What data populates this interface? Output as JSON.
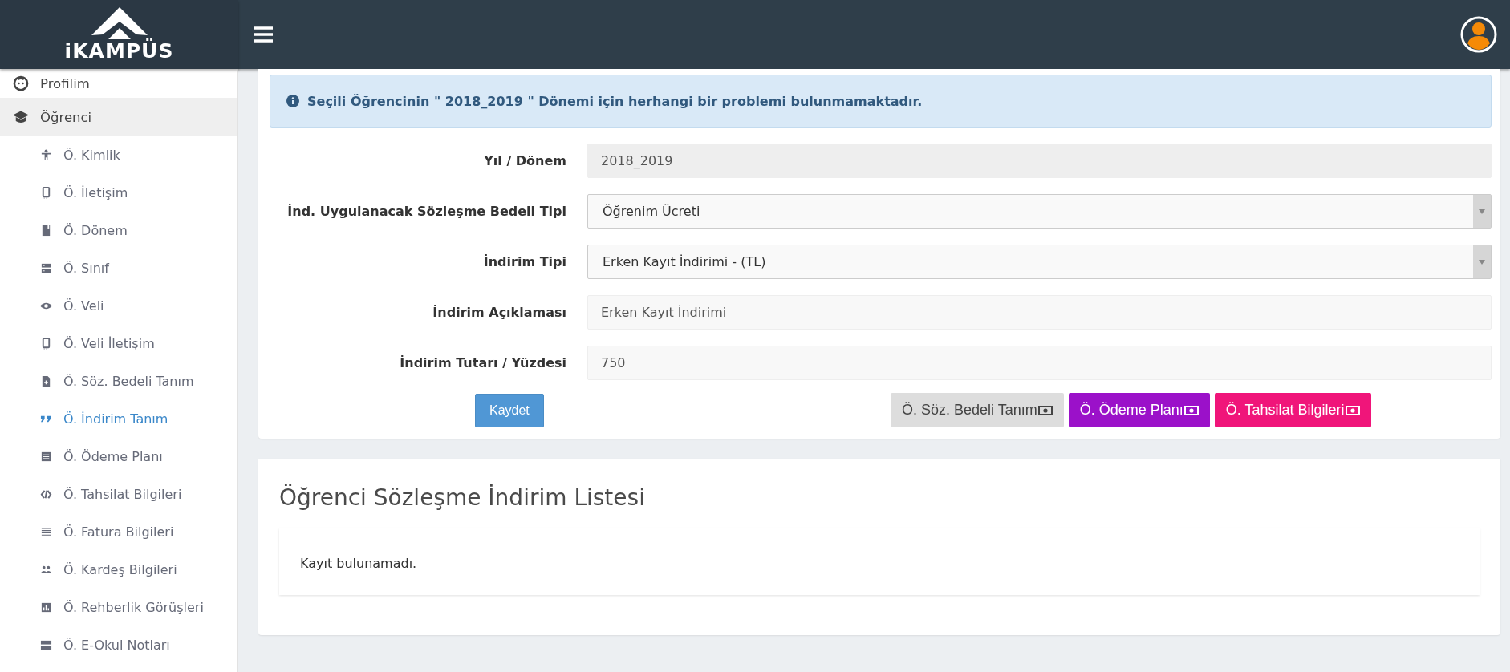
{
  "header": {
    "logo_text": "iKAMPÜS"
  },
  "sidebar": {
    "items": [
      {
        "label": "Profilim",
        "selected": false
      },
      {
        "label": "Öğrenci",
        "selected": true,
        "children": [
          {
            "label": "Ö. Kimlik",
            "selected": false
          },
          {
            "label": "Ö. İletişim",
            "selected": false
          },
          {
            "label": "Ö. Dönem",
            "selected": false
          },
          {
            "label": "Ö. Sınıf",
            "selected": false
          },
          {
            "label": "Ö. Veli",
            "selected": false
          },
          {
            "label": "Ö. Veli İletişim",
            "selected": false
          },
          {
            "label": "Ö. Söz. Bedeli Tanım",
            "selected": false
          },
          {
            "label": "Ö. İndirim Tanım",
            "selected": true
          },
          {
            "label": "Ö. Ödeme Planı",
            "selected": false
          },
          {
            "label": "Ö. Tahsilat Bilgileri",
            "selected": false
          },
          {
            "label": "Ö. Fatura Bilgileri",
            "selected": false
          },
          {
            "label": "Ö. Kardeş Bilgileri",
            "selected": false
          },
          {
            "label": "Ö. Rehberlik Görüşleri",
            "selected": false
          },
          {
            "label": "Ö. E-Okul Notları",
            "selected": false
          }
        ]
      }
    ]
  },
  "alert": {
    "text": "Seçili Öğrencinin \" 2018_2019 \" Dönemi için herhangi bir problemi bulunmamaktadır."
  },
  "form": {
    "fields": [
      {
        "label": "Yıl / Dönem",
        "kind": "readonly",
        "value": "2018_2019"
      },
      {
        "label": "İnd. Uygulanacak Sözleşme Bedeli Tipi",
        "kind": "select",
        "value": "Öğrenim Ücreti"
      },
      {
        "label": "İndirim Tipi",
        "kind": "select",
        "value": "Erken Kayıt İndirimi - (TL)"
      },
      {
        "label": "İndirim Açıklaması",
        "kind": "text",
        "value": "Erken Kayıt İndirimi"
      },
      {
        "label": "İndirim Tutarı / Yüzdesi",
        "kind": "text",
        "value": "750"
      }
    ],
    "save_button": "Kaydet",
    "link_buttons": [
      {
        "label": "Ö. Söz. Bedeli Tanım",
        "color": "#dddddd"
      },
      {
        "label": "Ö. Ödeme Planı",
        "color": "#9b11c9"
      },
      {
        "label": "Ö. Tahsilat Bilgileri",
        "color": "#f0157a"
      }
    ]
  },
  "list": {
    "title": "Öğrenci Sözleşme İndirim Listesi",
    "empty_text": "Kayıt bulunamadı."
  }
}
